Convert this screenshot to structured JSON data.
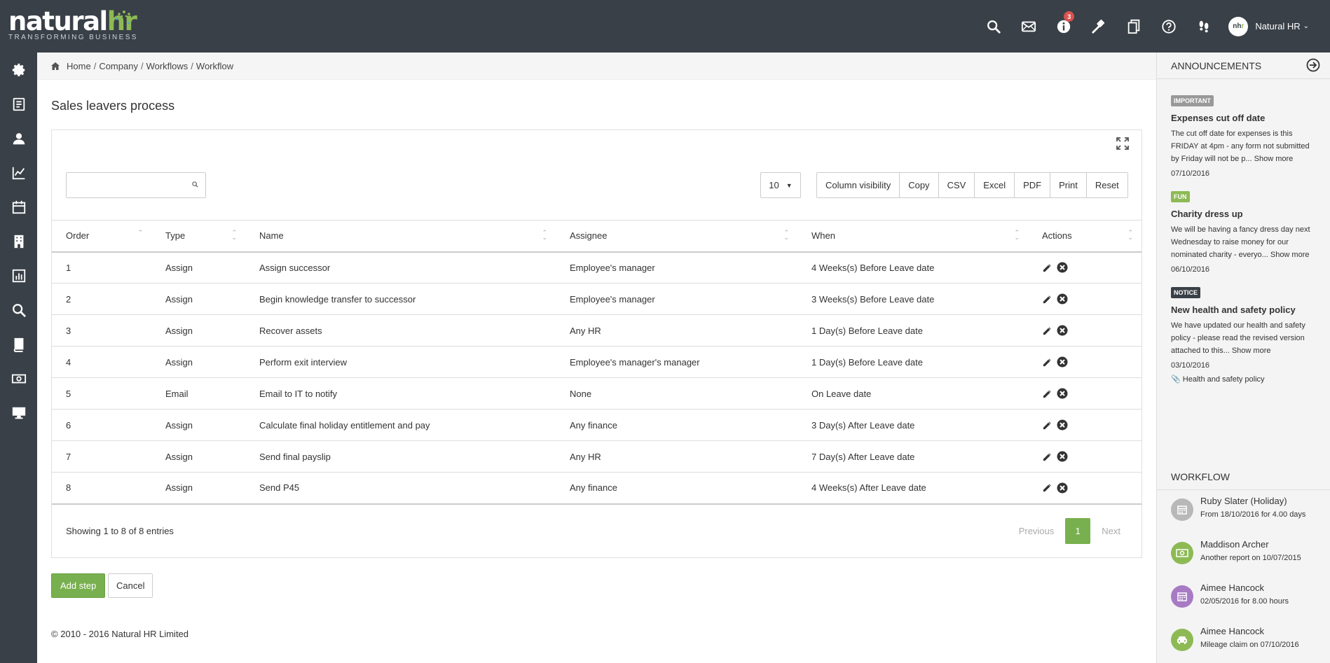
{
  "brand": {
    "word_main": "natural",
    "word_accent": "hr",
    "tagline": "TRANSFORMING BUSINESS"
  },
  "topbar": {
    "notification_count": "3",
    "user_initials_1": "nh",
    "user_initials_2": "r",
    "user_name": "Natural HR",
    "icons": [
      "search-icon",
      "mail-icon",
      "info-icon",
      "gavel-icon",
      "documents-icon",
      "help-icon",
      "footsteps-icon"
    ]
  },
  "sidebar": {
    "items": [
      "settings-icon",
      "reports-icon",
      "people-icon",
      "analytics-icon",
      "calendar-icon",
      "building-icon",
      "dashboard-icon",
      "search-icon",
      "book-icon",
      "money-icon",
      "desktop-icon"
    ]
  },
  "breadcrumb": {
    "home": "Home",
    "company": "Company",
    "workflows": "Workflows",
    "workflow": "Workflow",
    "sep": "/"
  },
  "page": {
    "title": "Sales leavers process"
  },
  "table_controls": {
    "search_value": "",
    "page_size": "10",
    "buttons": [
      "Column visibility",
      "Copy",
      "CSV",
      "Excel",
      "PDF",
      "Print",
      "Reset"
    ]
  },
  "table": {
    "columns": [
      "Order",
      "Type",
      "Name",
      "Assignee",
      "When",
      "Actions"
    ],
    "rows": [
      [
        "1",
        "Assign",
        "Assign successor",
        "Employee's manager",
        "4 Weeks(s) Before Leave date"
      ],
      [
        "2",
        "Assign",
        "Begin knowledge transfer to successor",
        "Employee's manager",
        "3 Weeks(s) Before Leave date"
      ],
      [
        "3",
        "Assign",
        "Recover assets",
        "Any HR",
        "1 Day(s) Before Leave date"
      ],
      [
        "4",
        "Assign",
        "Perform exit interview",
        "Employee's manager's manager",
        "1 Day(s) Before Leave date"
      ],
      [
        "5",
        "Email",
        "Email to IT to notify",
        "None",
        "On Leave date"
      ],
      [
        "6",
        "Assign",
        "Calculate final holiday entitlement and pay",
        "Any finance",
        "3 Day(s) After Leave date"
      ],
      [
        "7",
        "Assign",
        "Send final payslip",
        "Any HR",
        "7 Day(s) After Leave date"
      ],
      [
        "8",
        "Assign",
        "Send P45",
        "Any finance",
        "4 Weeks(s) After Leave date"
      ]
    ]
  },
  "footer_info": "Showing 1 to 8 of 8 entries",
  "pager": {
    "previous": "Previous",
    "current": "1",
    "next": "Next"
  },
  "actions": {
    "add_step": "Add step",
    "cancel": "Cancel"
  },
  "copyright": "© 2010 - 2016 Natural HR Limited",
  "announcements": {
    "heading": "ANNOUNCEMENTS",
    "items": [
      {
        "tag": "IMPORTANT",
        "tag_color": "#999999",
        "title": "Expenses cut off date",
        "body": "The cut off date for expenses is this FRIDAY at 4pm - any form not submitted by Friday will not be p...",
        "more": "Show more",
        "date": "07/10/2016",
        "attachment": ""
      },
      {
        "tag": "FUN",
        "tag_color": "#8dba55",
        "title": "Charity dress up",
        "body": "We will be having a fancy dress day next Wednesday to raise money for our nominated charity - everyo...",
        "more": "Show more",
        "date": "06/10/2016",
        "attachment": ""
      },
      {
        "tag": "NOTICE",
        "tag_color": "#394047",
        "title": "New health and safety policy",
        "body": "We have updated our health and safety policy - please read the revised version attached to this...",
        "more": "Show more",
        "date": "03/10/2016",
        "attachment": "Health and safety policy"
      }
    ]
  },
  "workflow_panel": {
    "heading": "WORKFLOW",
    "items": [
      {
        "name": "Ruby Slater (Holiday)",
        "detail": "From 18/10/2016 for 4.00 days",
        "color": "#b8b8b8",
        "icon": "calendar-icon"
      },
      {
        "name": "Maddison Archer",
        "detail": "Another report on 10/07/2015",
        "color": "#8dba55",
        "icon": "money-icon"
      },
      {
        "name": "Aimee Hancock",
        "detail": "02/05/2016 for 8.00 hours",
        "color": "#a77bc4",
        "icon": "calendar-icon"
      },
      {
        "name": "Aimee Hancock",
        "detail": "Mileage claim on 07/10/2016",
        "color": "#8dba55",
        "icon": "car-icon"
      }
    ]
  }
}
